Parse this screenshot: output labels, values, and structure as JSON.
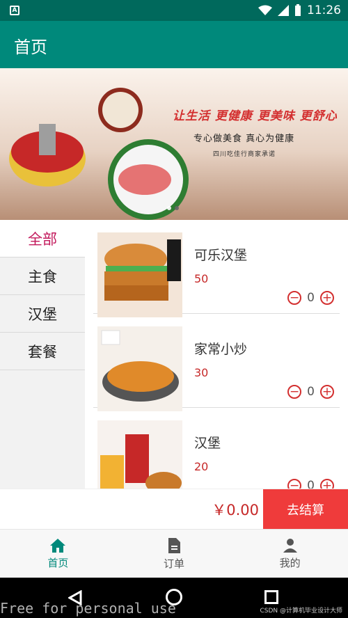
{
  "status": {
    "time": "11:26"
  },
  "toolbar": {
    "title": "首页"
  },
  "banner": {
    "slogan": "让生活 更健康 更美味 更舒心",
    "line1": "专心做美食  真心为健康",
    "line2": "四川吃佳行商家承诺"
  },
  "sidebar": {
    "items": [
      {
        "label": "全部",
        "active": true
      },
      {
        "label": "主食",
        "active": false
      },
      {
        "label": "汉堡",
        "active": false
      },
      {
        "label": "套餐",
        "active": false
      }
    ]
  },
  "products": [
    {
      "name": "可乐汉堡",
      "price": "50",
      "qty": "0"
    },
    {
      "name": "家常小炒",
      "price": "30",
      "qty": "0"
    },
    {
      "name": "汉堡",
      "price": "20",
      "qty": "0"
    }
  ],
  "checkout": {
    "total": "￥0.00",
    "button": "去结算"
  },
  "nav": {
    "home": "首页",
    "orders": "订单",
    "mine": "我的"
  },
  "colors": {
    "primary": "#00897b",
    "accent": "#ef3b3b",
    "active_text": "#c2185b"
  },
  "watermark": "Free for personal use",
  "credit": "CSDN @计算机毕业设计大师"
}
